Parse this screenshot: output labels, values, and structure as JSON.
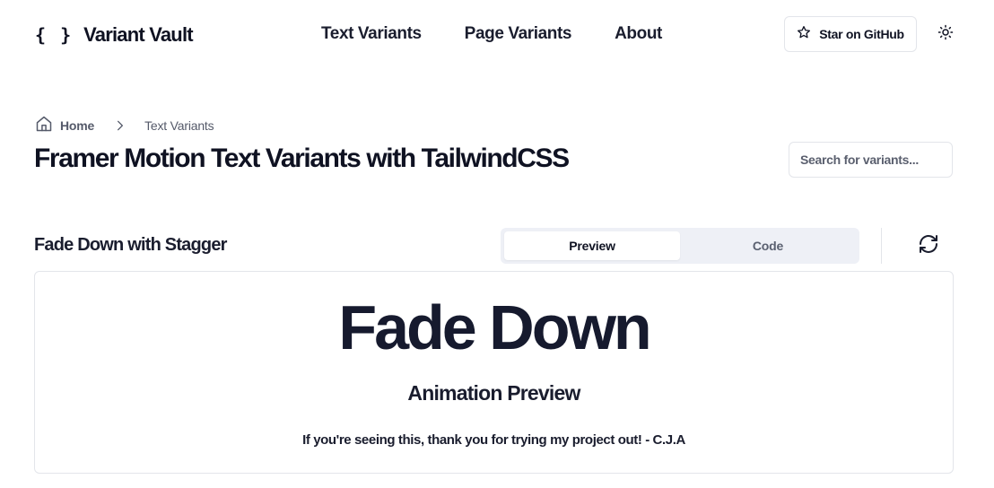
{
  "header": {
    "logo_glyph": "{ }",
    "logo_text": "Variant Vault",
    "nav": [
      "Text Variants",
      "Page Variants",
      "About"
    ],
    "github_label": "Star on GitHub",
    "github_icon": "star-icon",
    "theme_icon": "sun-icon"
  },
  "breadcrumb": {
    "home": "Home",
    "home_icon": "home-icon",
    "separator_icon": "chevron-right-icon",
    "current": "Text Variants"
  },
  "page_title": "Framer Motion Text Variants with TailwindCSS",
  "search": {
    "placeholder": "Search for variants...",
    "value": ""
  },
  "section": {
    "title": "Fade Down with Stagger",
    "tabs": [
      "Preview",
      "Code"
    ],
    "active_tab": "Preview",
    "refresh_icon": "refresh-icon"
  },
  "preview": {
    "heading": "Fade Down",
    "subheading": "Animation Preview",
    "note": "If you're seeing this, thank you for trying my project out! - C.J.A"
  },
  "colors": {
    "text": "#0f1222",
    "muted": "#555a6a",
    "border": "#e3e5ea",
    "tab_bg": "#eef0f6"
  }
}
